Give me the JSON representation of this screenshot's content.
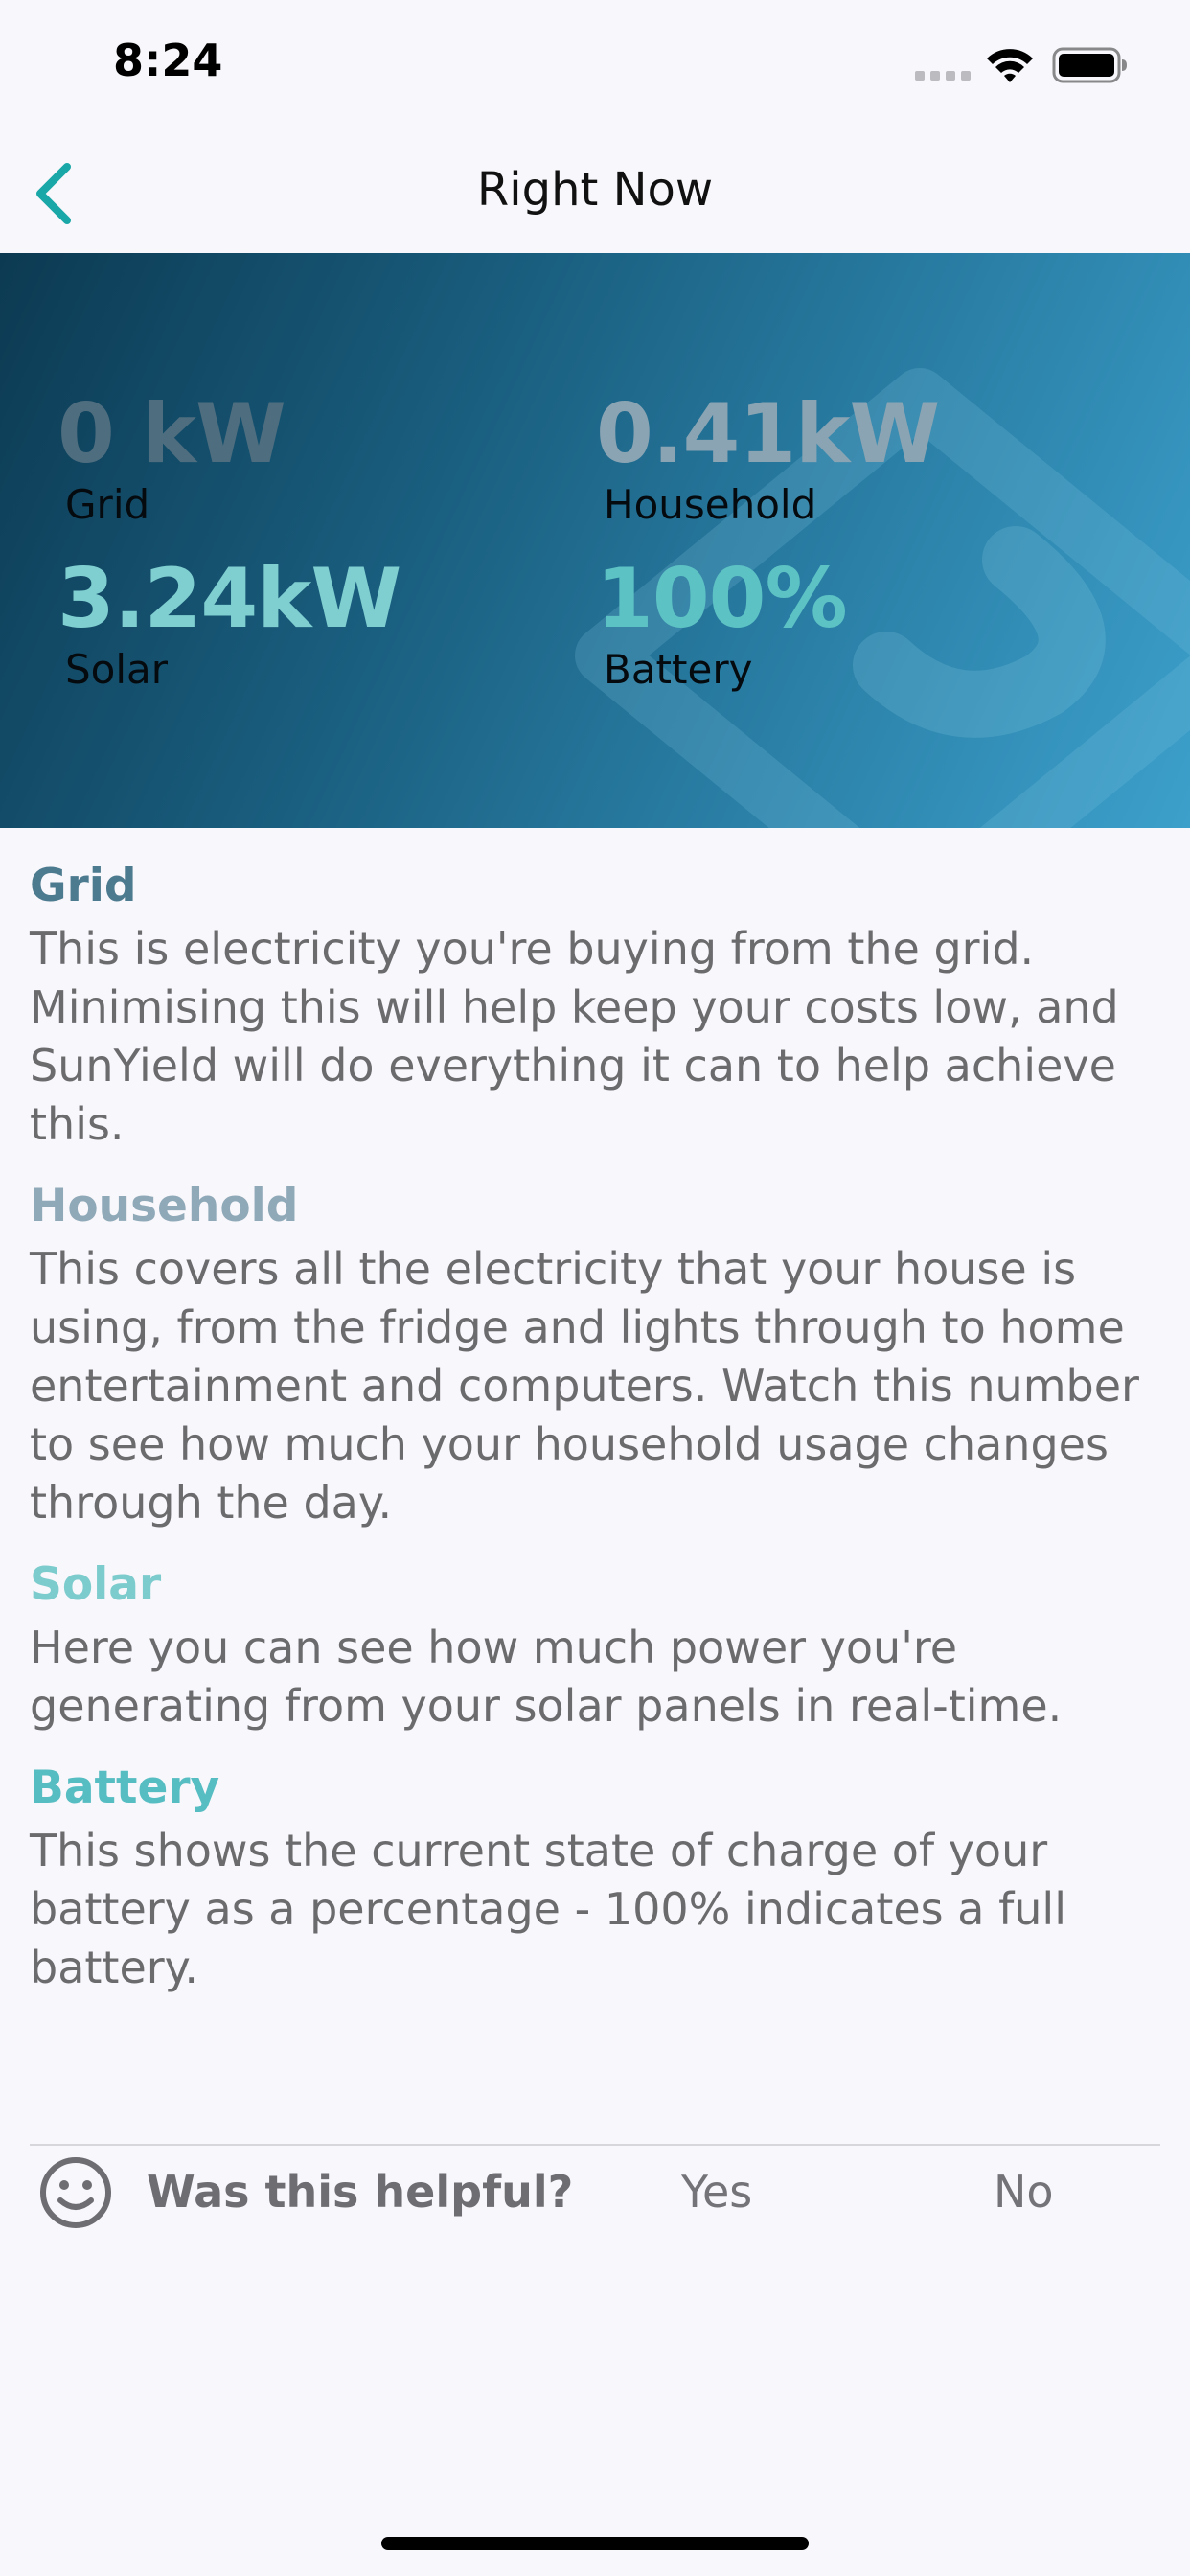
{
  "status_bar": {
    "time": "8:24"
  },
  "nav": {
    "title": "Right Now"
  },
  "metrics": {
    "grid": {
      "value": "0 kW",
      "label": "Grid"
    },
    "household": {
      "value": "0.41kW",
      "label": "Household"
    },
    "solar": {
      "value": "3.24kW",
      "label": "Solar"
    },
    "battery": {
      "value": "100%",
      "label": "Battery"
    }
  },
  "sections": [
    {
      "title": "Grid",
      "body": "This is electricity you're buying from the grid. Minimising this will help keep your costs low, and SunYield will do everything it can to help achieve this."
    },
    {
      "title": "Household",
      "body": "This covers all the electricity that your house is using, from the fridge and lights through to home entertainment and computers. Watch this number to see how much your household usage changes through the day."
    },
    {
      "title": "Solar",
      "body": "Here you can see how much power you're generating from your solar panels in real-time."
    },
    {
      "title": "Battery",
      "body": "This shows the current state of charge of your battery as a percentage - 100% indicates a full battery."
    }
  ],
  "feedback": {
    "question": "Was this helpful?",
    "yes": "Yes",
    "no": "No"
  },
  "colors": {
    "accent": "#1aa7a7",
    "grid": "#4c7a8e",
    "household": "#8fa9b8",
    "solar": "#7dcccd",
    "battery": "#56bdc2"
  },
  "icons": {
    "back": "chevron-left-icon",
    "signal": "signal-icon",
    "wifi": "wifi-icon",
    "battery": "battery-icon",
    "feedback": "smiley-icon"
  }
}
